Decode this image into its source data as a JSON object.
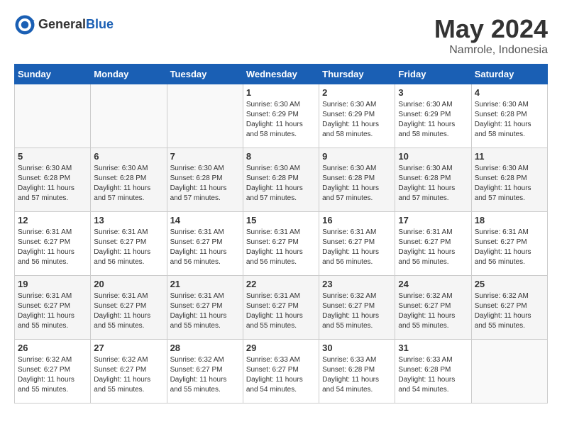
{
  "logo": {
    "general": "General",
    "blue": "Blue"
  },
  "title": {
    "month_year": "May 2024",
    "location": "Namrole, Indonesia"
  },
  "days_of_week": [
    "Sunday",
    "Monday",
    "Tuesday",
    "Wednesday",
    "Thursday",
    "Friday",
    "Saturday"
  ],
  "weeks": [
    [
      {
        "day": "",
        "info": ""
      },
      {
        "day": "",
        "info": ""
      },
      {
        "day": "",
        "info": ""
      },
      {
        "day": "1",
        "info": "Sunrise: 6:30 AM\nSunset: 6:29 PM\nDaylight: 11 hours and 58 minutes."
      },
      {
        "day": "2",
        "info": "Sunrise: 6:30 AM\nSunset: 6:29 PM\nDaylight: 11 hours and 58 minutes."
      },
      {
        "day": "3",
        "info": "Sunrise: 6:30 AM\nSunset: 6:29 PM\nDaylight: 11 hours and 58 minutes."
      },
      {
        "day": "4",
        "info": "Sunrise: 6:30 AM\nSunset: 6:28 PM\nDaylight: 11 hours and 58 minutes."
      }
    ],
    [
      {
        "day": "5",
        "info": "Sunrise: 6:30 AM\nSunset: 6:28 PM\nDaylight: 11 hours and 57 minutes."
      },
      {
        "day": "6",
        "info": "Sunrise: 6:30 AM\nSunset: 6:28 PM\nDaylight: 11 hours and 57 minutes."
      },
      {
        "day": "7",
        "info": "Sunrise: 6:30 AM\nSunset: 6:28 PM\nDaylight: 11 hours and 57 minutes."
      },
      {
        "day": "8",
        "info": "Sunrise: 6:30 AM\nSunset: 6:28 PM\nDaylight: 11 hours and 57 minutes."
      },
      {
        "day": "9",
        "info": "Sunrise: 6:30 AM\nSunset: 6:28 PM\nDaylight: 11 hours and 57 minutes."
      },
      {
        "day": "10",
        "info": "Sunrise: 6:30 AM\nSunset: 6:28 PM\nDaylight: 11 hours and 57 minutes."
      },
      {
        "day": "11",
        "info": "Sunrise: 6:30 AM\nSunset: 6:28 PM\nDaylight: 11 hours and 57 minutes."
      }
    ],
    [
      {
        "day": "12",
        "info": "Sunrise: 6:31 AM\nSunset: 6:27 PM\nDaylight: 11 hours and 56 minutes."
      },
      {
        "day": "13",
        "info": "Sunrise: 6:31 AM\nSunset: 6:27 PM\nDaylight: 11 hours and 56 minutes."
      },
      {
        "day": "14",
        "info": "Sunrise: 6:31 AM\nSunset: 6:27 PM\nDaylight: 11 hours and 56 minutes."
      },
      {
        "day": "15",
        "info": "Sunrise: 6:31 AM\nSunset: 6:27 PM\nDaylight: 11 hours and 56 minutes."
      },
      {
        "day": "16",
        "info": "Sunrise: 6:31 AM\nSunset: 6:27 PM\nDaylight: 11 hours and 56 minutes."
      },
      {
        "day": "17",
        "info": "Sunrise: 6:31 AM\nSunset: 6:27 PM\nDaylight: 11 hours and 56 minutes."
      },
      {
        "day": "18",
        "info": "Sunrise: 6:31 AM\nSunset: 6:27 PM\nDaylight: 11 hours and 56 minutes."
      }
    ],
    [
      {
        "day": "19",
        "info": "Sunrise: 6:31 AM\nSunset: 6:27 PM\nDaylight: 11 hours and 55 minutes."
      },
      {
        "day": "20",
        "info": "Sunrise: 6:31 AM\nSunset: 6:27 PM\nDaylight: 11 hours and 55 minutes."
      },
      {
        "day": "21",
        "info": "Sunrise: 6:31 AM\nSunset: 6:27 PM\nDaylight: 11 hours and 55 minutes."
      },
      {
        "day": "22",
        "info": "Sunrise: 6:31 AM\nSunset: 6:27 PM\nDaylight: 11 hours and 55 minutes."
      },
      {
        "day": "23",
        "info": "Sunrise: 6:32 AM\nSunset: 6:27 PM\nDaylight: 11 hours and 55 minutes."
      },
      {
        "day": "24",
        "info": "Sunrise: 6:32 AM\nSunset: 6:27 PM\nDaylight: 11 hours and 55 minutes."
      },
      {
        "day": "25",
        "info": "Sunrise: 6:32 AM\nSunset: 6:27 PM\nDaylight: 11 hours and 55 minutes."
      }
    ],
    [
      {
        "day": "26",
        "info": "Sunrise: 6:32 AM\nSunset: 6:27 PM\nDaylight: 11 hours and 55 minutes."
      },
      {
        "day": "27",
        "info": "Sunrise: 6:32 AM\nSunset: 6:27 PM\nDaylight: 11 hours and 55 minutes."
      },
      {
        "day": "28",
        "info": "Sunrise: 6:32 AM\nSunset: 6:27 PM\nDaylight: 11 hours and 55 minutes."
      },
      {
        "day": "29",
        "info": "Sunrise: 6:33 AM\nSunset: 6:27 PM\nDaylight: 11 hours and 54 minutes."
      },
      {
        "day": "30",
        "info": "Sunrise: 6:33 AM\nSunset: 6:28 PM\nDaylight: 11 hours and 54 minutes."
      },
      {
        "day": "31",
        "info": "Sunrise: 6:33 AM\nSunset: 6:28 PM\nDaylight: 11 hours and 54 minutes."
      },
      {
        "day": "",
        "info": ""
      }
    ]
  ]
}
